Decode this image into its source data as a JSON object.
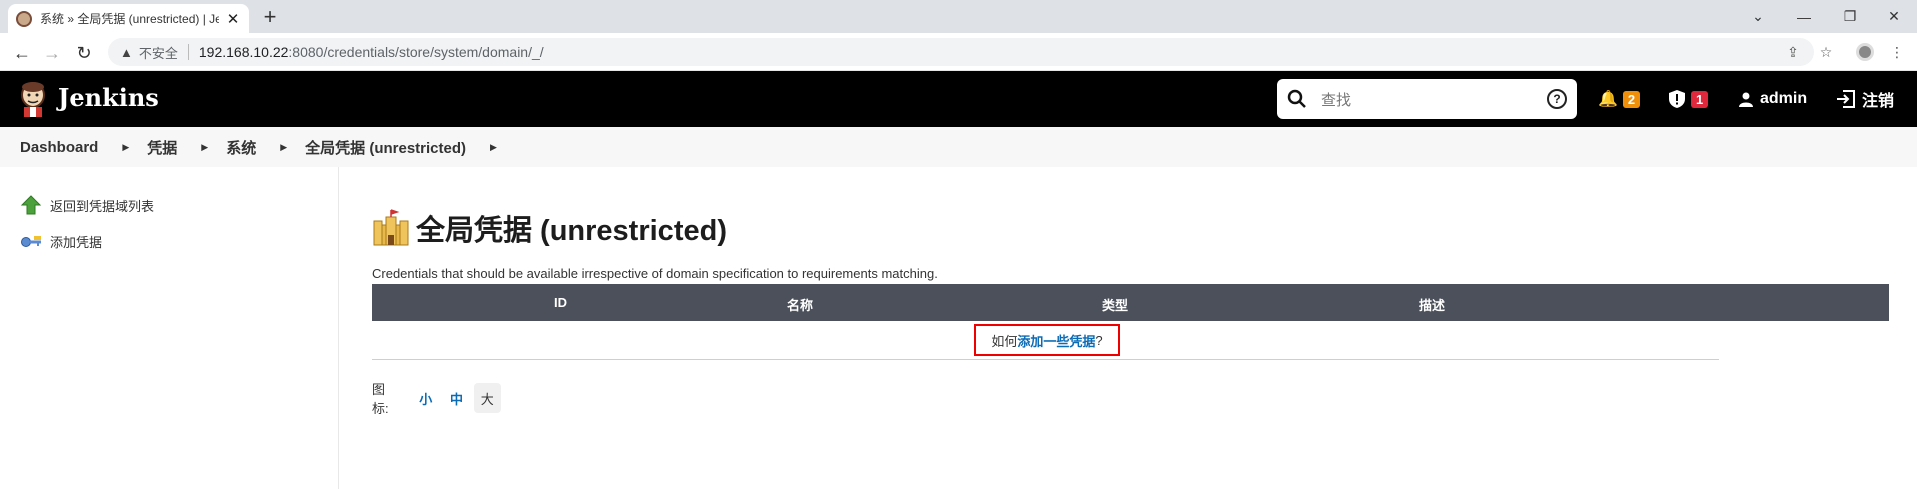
{
  "browser": {
    "tab_title": "系统 » 全局凭据 (unrestricted) | Jenkins",
    "security_label": "不安全",
    "url_host": "192.168.10.22",
    "url_path": ":8080/credentials/store/system/domain/_/"
  },
  "header": {
    "app_name": "Jenkins",
    "search_placeholder": "查找",
    "notifications_count": "2",
    "security_count": "1",
    "user": "admin",
    "logout": "注销",
    "notification_badge_color": "#f0900a",
    "security_badge_color": "#e0283c"
  },
  "breadcrumbs": [
    "Dashboard",
    "凭据",
    "系统",
    "全局凭据 (unrestricted)"
  ],
  "sidebar": {
    "items": [
      {
        "label": "返回到凭据域列表",
        "icon": "up-arrow-icon"
      },
      {
        "label": "添加凭据",
        "icon": "key-icon"
      }
    ]
  },
  "main": {
    "title": "全局凭据 (unrestricted)",
    "description": "Credentials that should be available irrespective of domain specification to requirements matching.",
    "table": {
      "columns": [
        "ID",
        "名称",
        "类型",
        "描述"
      ]
    },
    "empty_prefix": "如何",
    "empty_link": "添加一些凭据",
    "empty_suffix": "?",
    "icon_size_label": "图标:",
    "icon_sizes": [
      "小",
      "中",
      "大"
    ]
  }
}
